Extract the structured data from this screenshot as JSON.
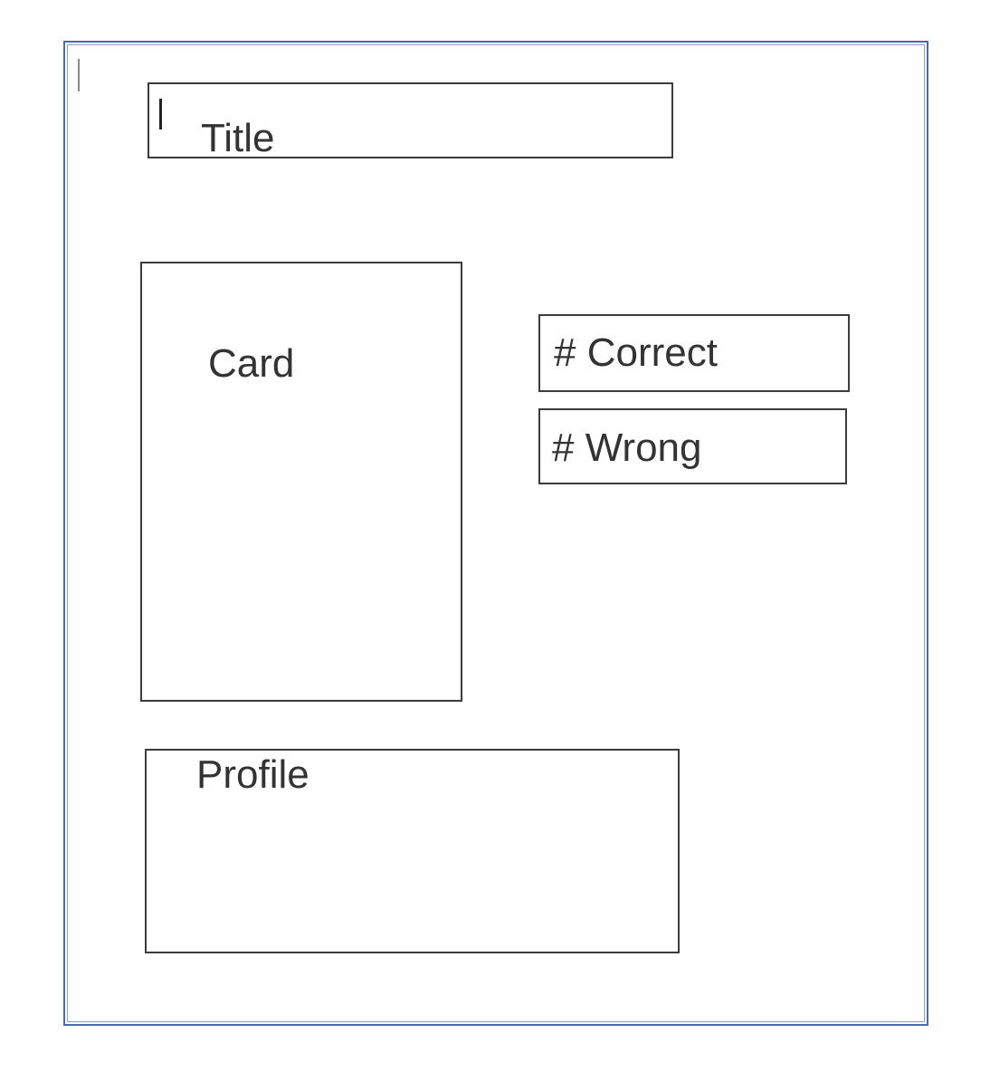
{
  "wireframe": {
    "title_label": "Title",
    "card_label": "Card",
    "correct_label": "# Correct",
    "wrong_label": "# Wrong",
    "profile_label": "Profile"
  },
  "colors": {
    "frame_border": "#4a6cad",
    "box_border": "#3c3c3c",
    "text": "#333333"
  }
}
